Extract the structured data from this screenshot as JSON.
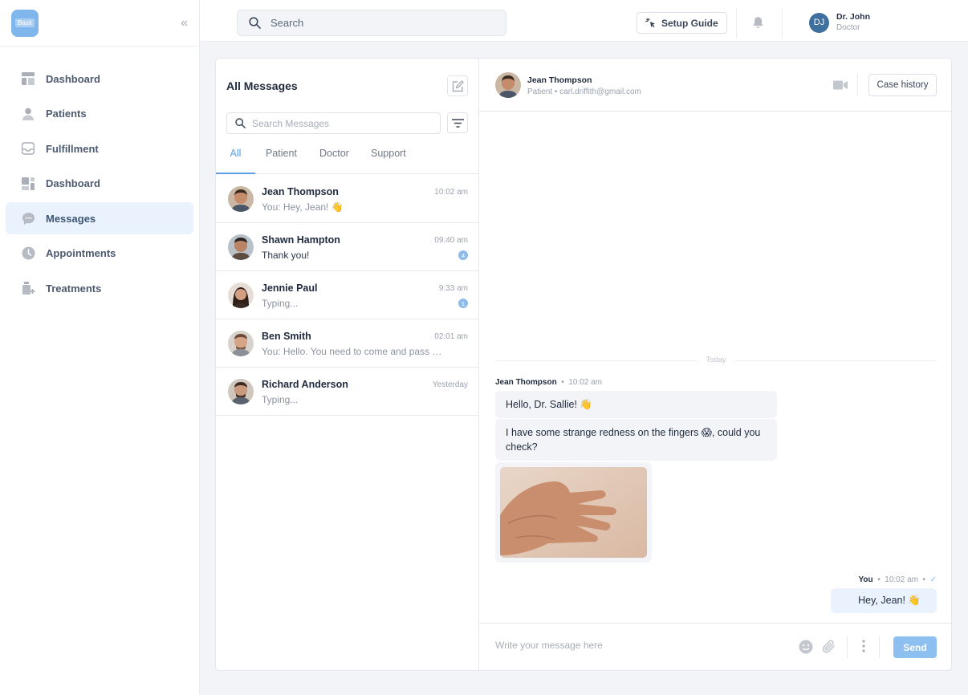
{
  "app": {
    "logo_text": "Bask"
  },
  "sidebar": {
    "items": [
      {
        "label": "Dashboard",
        "icon": "layout-icon"
      },
      {
        "label": "Patients",
        "icon": "user-icon"
      },
      {
        "label": "Fulfillment",
        "icon": "inbox-icon"
      },
      {
        "label": "Dashboard",
        "icon": "dashboard-icon"
      },
      {
        "label": "Messages",
        "icon": "chat-icon"
      },
      {
        "label": "Appointments",
        "icon": "clock-icon"
      },
      {
        "label": "Treatments",
        "icon": "treatment-icon"
      }
    ],
    "active_index": 4
  },
  "topbar": {
    "search_placeholder": "Search",
    "setup_label": "Setup Guide",
    "user_initials": "DJ",
    "user_name": "Dr. John",
    "user_role": "Doctor"
  },
  "messages": {
    "title": "All Messages",
    "search_placeholder": "Search Messages",
    "tabs": [
      "All",
      "Patient",
      "Doctor",
      "Support"
    ],
    "active_tab": 0,
    "conversations": [
      {
        "name": "Jean Thompson",
        "preview": "You: Hey, Jean! 👋",
        "time": "10:02 am",
        "badge": ""
      },
      {
        "name": "Shawn Hampton",
        "preview": "Thank you!",
        "time": "09:40 am",
        "badge": "4"
      },
      {
        "name": "Jennie Paul",
        "preview": "Typing...",
        "time": "9:33 am",
        "badge": "1"
      },
      {
        "name": "Ben Smith",
        "preview": "You: Hello. You need to come and pass a...",
        "time": "02:01 am",
        "badge": ""
      },
      {
        "name": "Richard Anderson",
        "preview": "Typing...",
        "time": "Yesterday",
        "badge": ""
      }
    ]
  },
  "chat": {
    "contact_name": "Jean Thompson",
    "contact_sub": "Patient  •  carl.driffith@gmail.com",
    "case_history_label": "Case history",
    "divider_label": "Today",
    "incoming_sender": "Jean Thompson",
    "incoming_time": "10:02 am",
    "incoming_messages": [
      "Hello, Dr. Sallie! 👋",
      "I have some strange redness on the fingers 😱, could you check?"
    ],
    "outgoing_sender": "You",
    "outgoing_time": "10:02 am",
    "outgoing_message": "Hey, Jean! 👋",
    "composer_placeholder": "Write your message here",
    "send_label": "Send"
  }
}
